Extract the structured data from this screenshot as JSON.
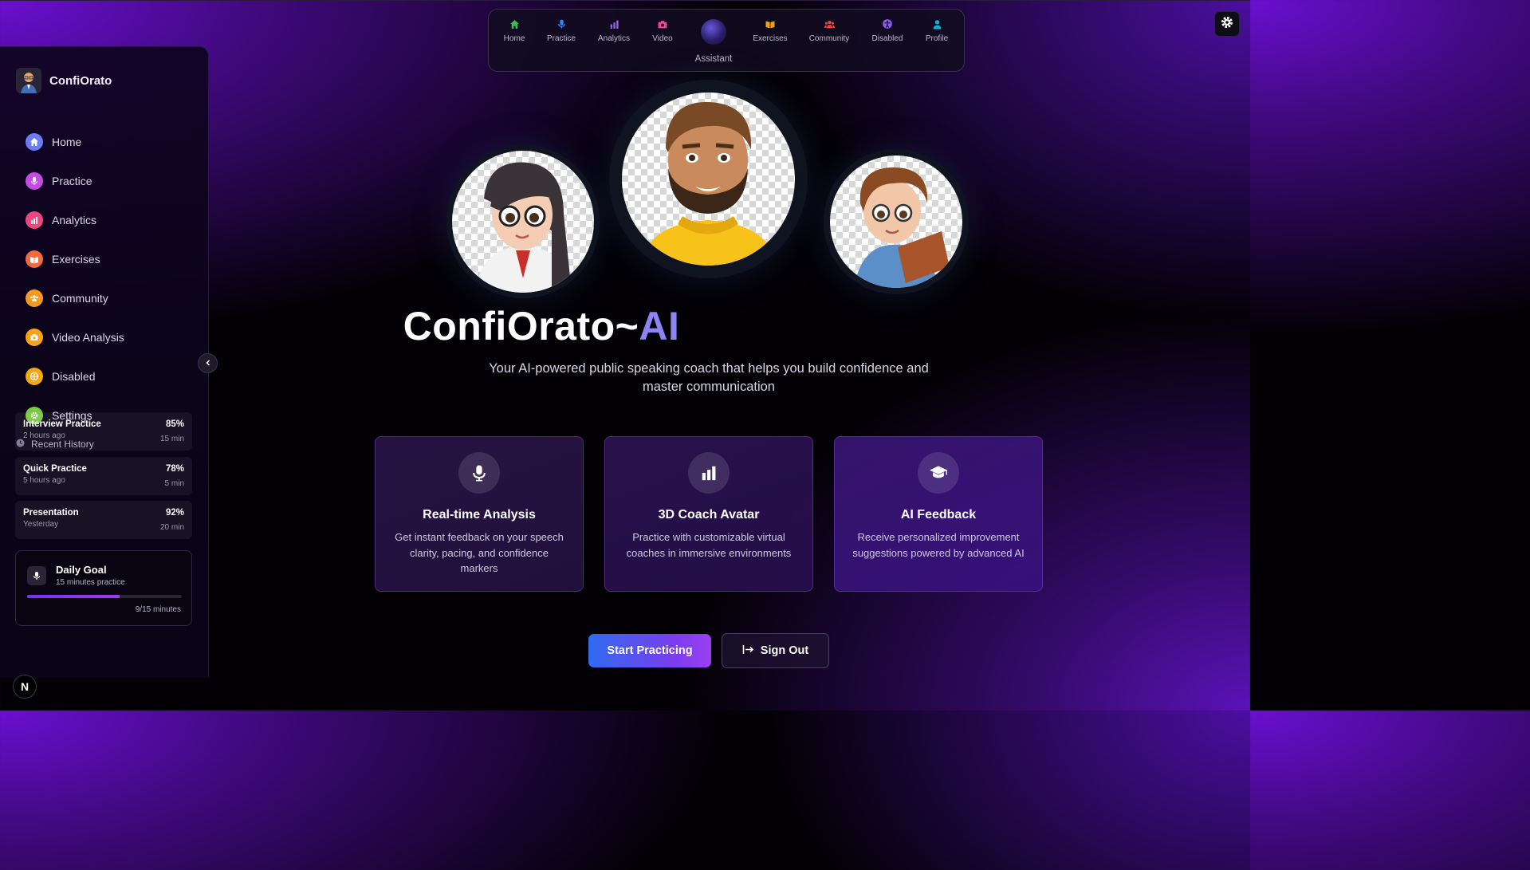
{
  "brand": {
    "name": "ConfiOrato"
  },
  "sidebar": {
    "items": [
      {
        "label": "Home",
        "icon": "home-icon",
        "color": "#6b7cf6"
      },
      {
        "label": "Practice",
        "icon": "microphone-icon",
        "color": "#c44de0"
      },
      {
        "label": "Analytics",
        "icon": "bar-chart-icon",
        "color": "#f0467f"
      },
      {
        "label": "Exercises",
        "icon": "book-icon",
        "color": "#f26a3c"
      },
      {
        "label": "Community",
        "icon": "users-icon",
        "color": "#f59a1f"
      },
      {
        "label": "Video Analysis",
        "icon": "camera-icon",
        "color": "#f7a21a"
      },
      {
        "label": "Disabled",
        "icon": "accessibility-icon",
        "color": "#f0a818"
      },
      {
        "label": "Settings",
        "icon": "gear-icon",
        "color": "#7ac943"
      }
    ],
    "history_title": "Recent History",
    "history": [
      {
        "title": "Interview Practice",
        "time": "2 hours ago",
        "score": "85%",
        "duration": "15 min"
      },
      {
        "title": "Quick Practice",
        "time": "5 hours ago",
        "score": "78%",
        "duration": "5 min"
      },
      {
        "title": "Presentation",
        "time": "Yesterday",
        "score": "92%",
        "duration": "20 min"
      }
    ],
    "goal": {
      "title": "Daily Goal",
      "subtitle": "15 minutes practice",
      "progress": 0.6,
      "count": "9/15 minutes"
    }
  },
  "topnav": {
    "items": [
      {
        "label": "Home",
        "icon": "home-icon",
        "color": "#3fb950"
      },
      {
        "label": "Practice",
        "icon": "microphone-icon",
        "color": "#3b82f6"
      },
      {
        "label": "Analytics",
        "icon": "bar-chart-icon",
        "color": "#a855f7"
      },
      {
        "label": "Video",
        "icon": "camera-icon",
        "color": "#ec4899"
      },
      {
        "label": "Exercises",
        "icon": "book-icon",
        "color": "#f59e0b"
      },
      {
        "label": "Community",
        "icon": "users-icon",
        "color": "#ef4444"
      },
      {
        "label": "Disabled",
        "icon": "accessibility-icon",
        "color": "#8b5cf6"
      },
      {
        "label": "Profile",
        "icon": "user-icon",
        "color": "#06b6d4"
      }
    ],
    "assistant_label": "Assistant"
  },
  "hero": {
    "title_main": "ConfiOrato~",
    "title_accent": "AI",
    "subtitle": "Your AI-powered public speaking coach that helps you build confidence and master communication"
  },
  "features": [
    {
      "title": "Real-time Analysis",
      "desc": "Get instant feedback on your speech clarity, pacing, and confidence markers",
      "icon": "microphone-icon"
    },
    {
      "title": "3D Coach Avatar",
      "desc": "Practice with customizable virtual coaches in immersive environments",
      "icon": "bar-chart-icon"
    },
    {
      "title": "AI Feedback",
      "desc": "Receive personalized improvement suggestions powered by advanced AI",
      "icon": "graduation-cap-icon"
    }
  ],
  "actions": {
    "start": "Start Practicing",
    "signout": "Sign Out"
  },
  "badge": "N"
}
